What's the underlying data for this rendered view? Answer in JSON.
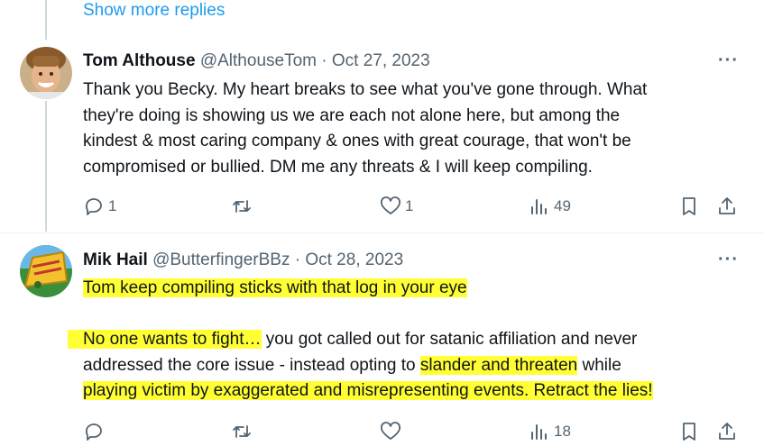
{
  "show_more": "Show more replies",
  "tweets": [
    {
      "name": "Tom Althouse",
      "handle": "@AlthouseTom",
      "sep": " · ",
      "date": "Oct 27, 2023",
      "more": "···",
      "text_lines": [
        "Thank you Becky. My heart breaks to see what you've gone through. What",
        "they're doing is showing us we are each not alone here, but among the",
        "kindest & most caring company & ones with great courage, that won't be",
        "compromised or bullied. DM me any threats & I will keep compiling."
      ],
      "replies": "1",
      "retweets": "",
      "likes": "1",
      "views": "49"
    },
    {
      "name": "Mik Hail",
      "handle": "@ButterfingerBBz",
      "sep": " · ",
      "date": "Oct 28, 2023",
      "more": "···",
      "line1": "Tom keep compiling sticks with that log in your eye ",
      "line2_hl": "No one wants to fight…",
      "line2_rest": " you got called out for satanic affiliation and never",
      "line3_a": "addressed the core issue - instead opting to ",
      "line3_hl": "slander and threaten",
      "line3_b": " while",
      "line4_hl": "playing victim by exaggerated and misrepresenting events. Retract the lies!",
      "replies": "",
      "retweets": "",
      "likes": "",
      "views": "18"
    }
  ],
  "colors": {
    "highlight": "#ffff33",
    "link": "#1d9bf0",
    "muted": "#536471"
  }
}
